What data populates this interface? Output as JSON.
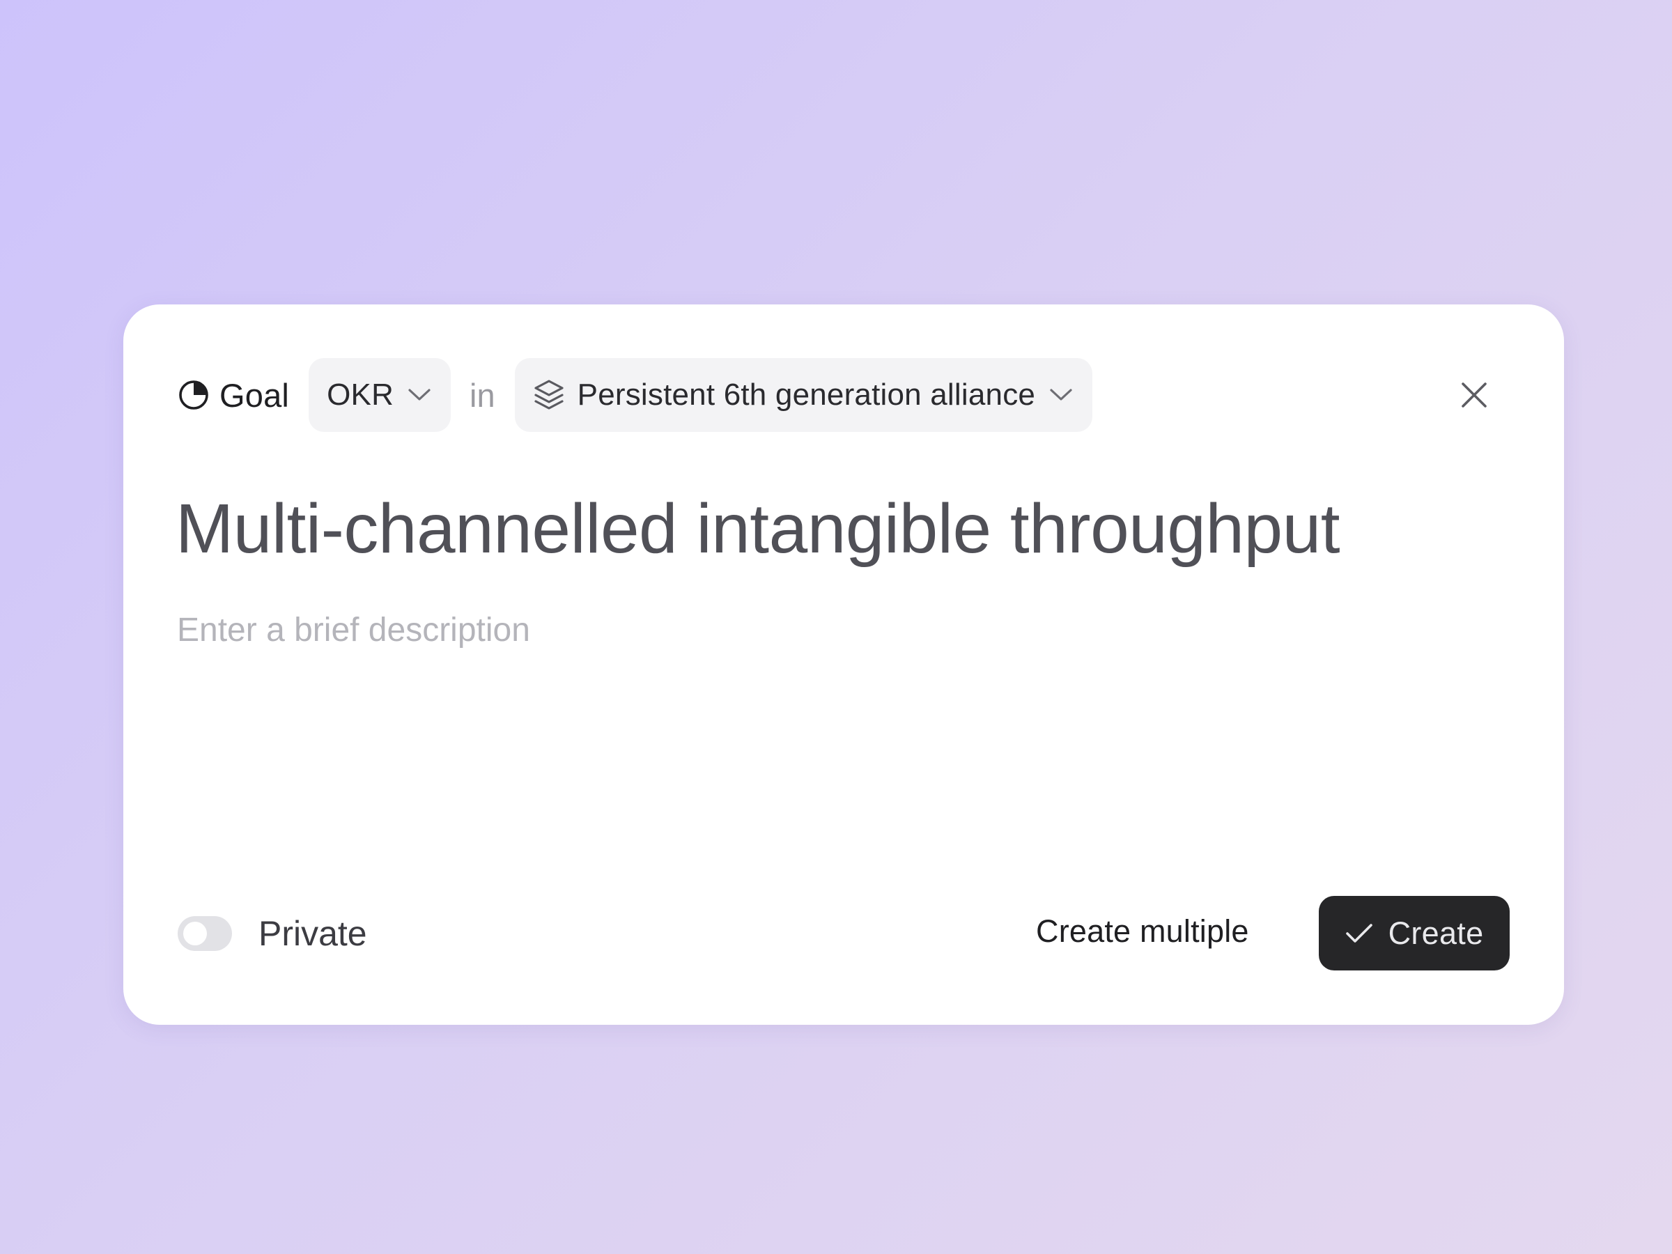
{
  "header": {
    "entity_icon": "pie-chart-icon",
    "entity_label": "Goal",
    "type_select": {
      "value": "OKR",
      "icon": "chevron-down-icon"
    },
    "connector_text": "in",
    "project_select": {
      "icon": "layers-icon",
      "value": "Persistent 6th generation alliance",
      "chevron": "chevron-down-icon"
    },
    "close_icon": "close-icon"
  },
  "form": {
    "title": "Multi-channelled intangible throughput",
    "description_placeholder": "Enter a brief description",
    "description_value": ""
  },
  "footer": {
    "private_toggle": {
      "label": "Private",
      "checked": false
    },
    "create_multiple_label": "Create multiple",
    "create_button": {
      "icon": "check-icon",
      "label": "Create"
    }
  },
  "colors": {
    "primary_button_bg": "#262628",
    "pill_bg": "#f3f3f5",
    "background_start": "#cdc3fb",
    "background_end": "#e4d8ef"
  }
}
